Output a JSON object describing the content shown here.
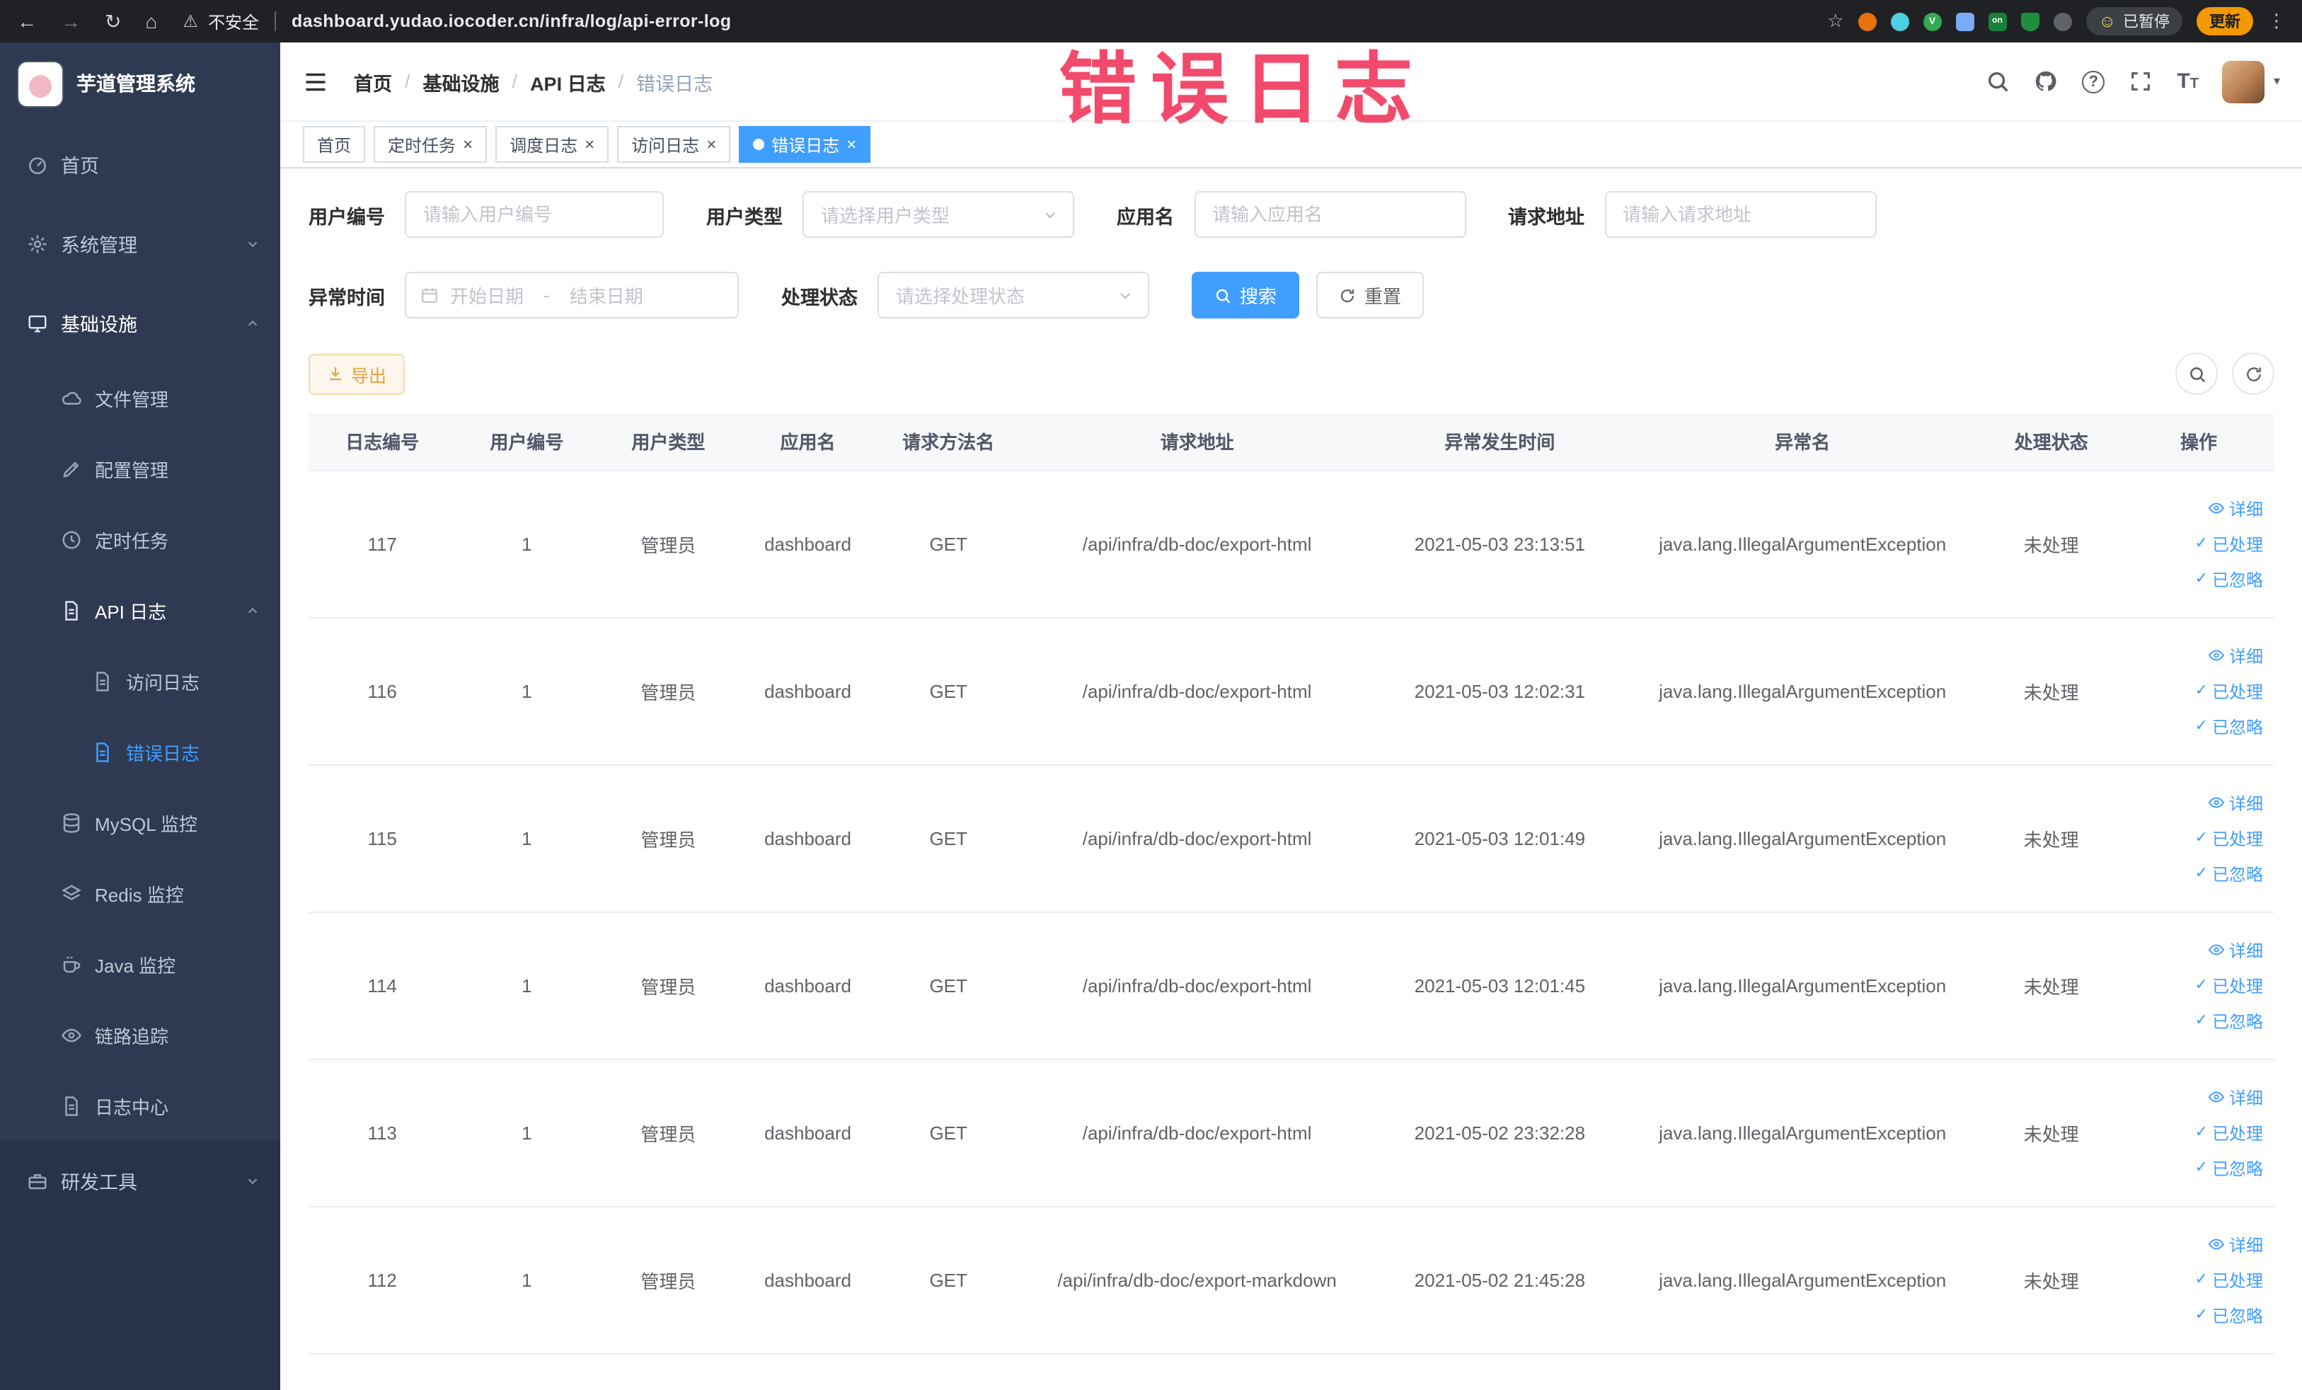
{
  "browser": {
    "security_label": "不安全",
    "url": "dashboard.yudao.iocoder.cn/infra/log/api-error-log",
    "ext_v": "V",
    "ext_on": "on",
    "paused_badge": "已暂停",
    "update_button": "更新"
  },
  "overlay": {
    "text": "错误日志"
  },
  "icons": {
    "back": "←",
    "forward": "→",
    "reload": "↻",
    "home": "⌂",
    "warning": "⚠",
    "star": "☆",
    "more": "⋮",
    "smiley": "☺",
    "question": "?",
    "caret_down": "▾",
    "close": "×",
    "check": "✓",
    "range_separator": "-",
    "fontsize_big": "T",
    "fontsize_small": "T"
  },
  "colors": {
    "accent": "#409eff",
    "overlay_red": "#f14a6c",
    "warning": "#e6a23c",
    "sidebar_bg": "#2f3a52"
  },
  "sidebar": {
    "title": "芋道管理系统",
    "items": [
      {
        "label": "首页"
      },
      {
        "label": "系统管理"
      },
      {
        "label": "基础设施"
      },
      {
        "label": "文件管理"
      },
      {
        "label": "配置管理"
      },
      {
        "label": "定时任务"
      },
      {
        "label": "API 日志"
      },
      {
        "label": "访问日志"
      },
      {
        "label": "错误日志"
      },
      {
        "label": "MySQL 监控"
      },
      {
        "label": "Redis 监控"
      },
      {
        "label": "Java 监控"
      },
      {
        "label": "链路追踪"
      },
      {
        "label": "日志中心"
      },
      {
        "label": "研发工具"
      }
    ]
  },
  "breadcrumb": {
    "separator": "/",
    "items": [
      "首页",
      "基础设施",
      "API 日志",
      "错误日志"
    ]
  },
  "tabs": [
    {
      "label": "首页"
    },
    {
      "label": "定时任务"
    },
    {
      "label": "调度日志"
    },
    {
      "label": "访问日志"
    },
    {
      "label": "错误日志"
    }
  ],
  "filters": {
    "user_id_label": "用户编号",
    "user_id_placeholder": "请输入用户编号",
    "user_type_label": "用户类型",
    "user_type_placeholder": "请选择用户类型",
    "app_name_label": "应用名",
    "app_name_placeholder": "请输入应用名",
    "request_url_label": "请求地址",
    "request_url_placeholder": "请输入请求地址",
    "time_label": "异常时间",
    "time_start_placeholder": "开始日期",
    "time_end_placeholder": "结束日期",
    "status_label": "处理状态",
    "status_placeholder": "请选择处理状态",
    "search_button": "搜索",
    "reset_button": "重置"
  },
  "toolbar": {
    "export_button": "导出"
  },
  "table": {
    "columns": [
      "日志编号",
      "用户编号",
      "用户类型",
      "应用名",
      "请求方法名",
      "请求地址",
      "异常发生时间",
      "异常名",
      "处理状态",
      "操作"
    ],
    "actions": [
      "详细",
      "已处理",
      "已忽略"
    ],
    "rows": [
      {
        "id": "117",
        "user_id": "1",
        "user_type": "管理员",
        "app": "dashboard",
        "method": "GET",
        "url": "/api/infra/db-doc/export-html",
        "time": "2021-05-03 23:13:51",
        "exception": "java.lang.IllegalArgumentException",
        "status": "未处理"
      },
      {
        "id": "116",
        "user_id": "1",
        "user_type": "管理员",
        "app": "dashboard",
        "method": "GET",
        "url": "/api/infra/db-doc/export-html",
        "time": "2021-05-03 12:02:31",
        "exception": "java.lang.IllegalArgumentException",
        "status": "未处理"
      },
      {
        "id": "115",
        "user_id": "1",
        "user_type": "管理员",
        "app": "dashboard",
        "method": "GET",
        "url": "/api/infra/db-doc/export-html",
        "time": "2021-05-03 12:01:49",
        "exception": "java.lang.IllegalArgumentException",
        "status": "未处理"
      },
      {
        "id": "114",
        "user_id": "1",
        "user_type": "管理员",
        "app": "dashboard",
        "method": "GET",
        "url": "/api/infra/db-doc/export-html",
        "time": "2021-05-03 12:01:45",
        "exception": "java.lang.IllegalArgumentException",
        "status": "未处理"
      },
      {
        "id": "113",
        "user_id": "1",
        "user_type": "管理员",
        "app": "dashboard",
        "method": "GET",
        "url": "/api/infra/db-doc/export-html",
        "time": "2021-05-02 23:32:28",
        "exception": "java.lang.IllegalArgumentException",
        "status": "未处理"
      },
      {
        "id": "112",
        "user_id": "1",
        "user_type": "管理员",
        "app": "dashboard",
        "method": "GET",
        "url": "/api/infra/db-doc/export-markdown",
        "time": "2021-05-02 21:45:28",
        "exception": "java.lang.IllegalArgumentException",
        "status": "未处理"
      }
    ]
  }
}
